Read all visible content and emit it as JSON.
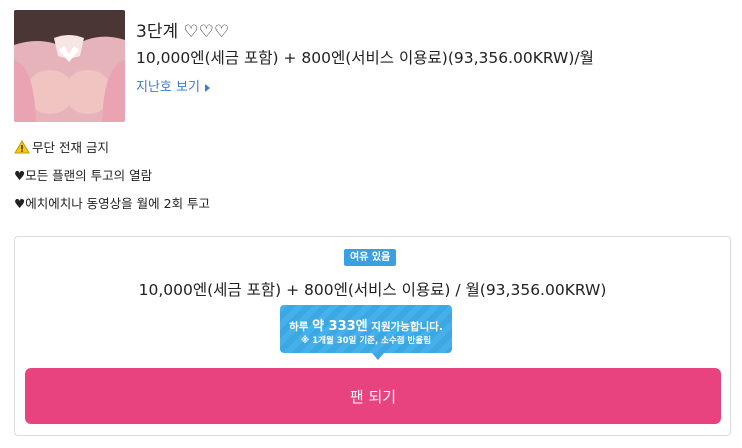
{
  "plan": {
    "title": "3단계 ♡♡♡",
    "price": "10,000엔(세금 포함) + 800엔(서비스 이용료)(93,356.00KRW)/월",
    "back_issues_label": "지난호 보기"
  },
  "description": [
    "무단 전재 금지",
    "♥모든 플랜의 투고의 열람",
    "♥에치에치나 동영상을 월에 2회 투고"
  ],
  "join_panel": {
    "badge": "여유 있음",
    "price": "10,000엔(세금 포함) + 800엔(서비스 이용료) / 월(93,356.00KRW)",
    "tooltip_prefix": "하루 ",
    "tooltip_amount": "약 333엔",
    "tooltip_suffix": " 지원가능합니다.",
    "tooltip_note": "※ 1개월 30일 기준, 소수점 반올림",
    "button_label": "팬 되기"
  },
  "colors": {
    "link": "#3a7bd5",
    "badge": "#3aa0e0",
    "tooltip": "#45b0ea",
    "button": "#e9437f"
  },
  "icons": [
    "warning-icon",
    "chevron-right-icon"
  ]
}
